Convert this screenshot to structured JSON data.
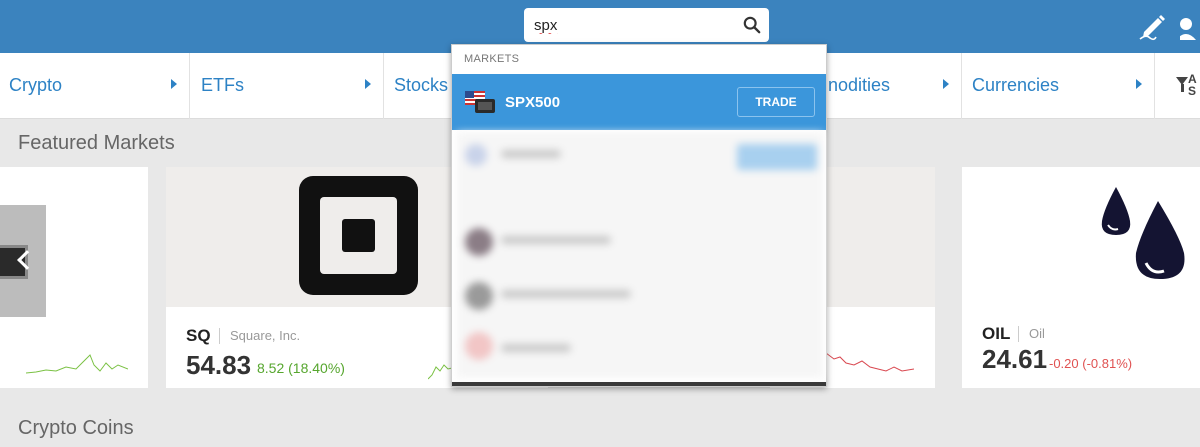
{
  "search": {
    "value": "spx",
    "icon": "search-icon"
  },
  "header": {
    "edit_icon": "pencil-icon",
    "user_icon": "user-icon",
    "colors": {
      "bar": "#3b83be"
    }
  },
  "categories": [
    {
      "label": "Crypto"
    },
    {
      "label": "ETFs"
    },
    {
      "label": "Stocks"
    },
    {
      "label": "nodities"
    },
    {
      "label": "Currencies"
    }
  ],
  "filter": {
    "label": "A S"
  },
  "sections": {
    "featured": "Featured Markets",
    "crypto": "Crypto Coins"
  },
  "cards": [
    {
      "symbol": "SQ",
      "name": "Square, Inc.",
      "price": "54.83",
      "change": "8.52 (18.40%)",
      "direction": "up"
    },
    {
      "symbol": "OIL",
      "name": "Oil",
      "price": "24.61",
      "change": "-0.20 (-0.81%)",
      "direction": "down"
    }
  ],
  "dropdown": {
    "heading": "MARKETS",
    "result": {
      "symbol": "SPX500",
      "trade_label": "TRADE",
      "flag_icon": "us-flag-icon"
    }
  },
  "colors": {
    "accent": "#2d82c5",
    "highlight": "#3b96db",
    "up": "#56a62e",
    "down": "#e05252"
  }
}
